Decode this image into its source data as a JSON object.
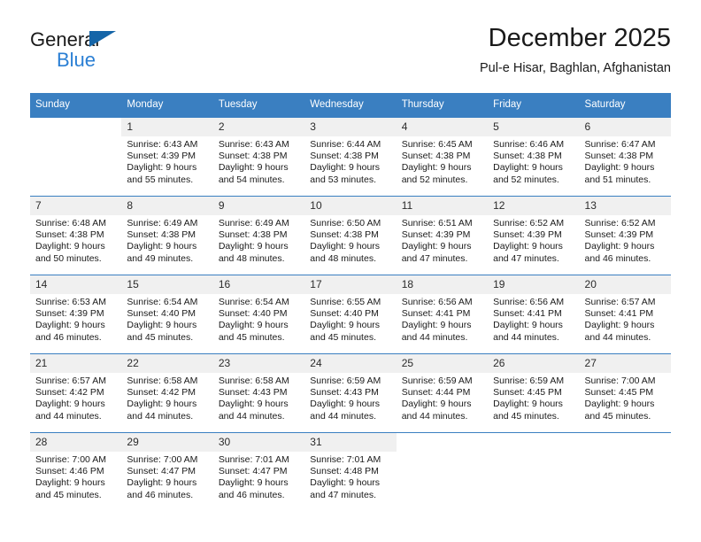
{
  "logo": {
    "word1": "General",
    "word2": "Blue",
    "triangle_color": "#1565a8",
    "word2_color": "#2a7fd4"
  },
  "header": {
    "title": "December 2025",
    "subtitle": "Pul-e Hisar, Baghlan, Afghanistan"
  },
  "theme": {
    "header_blue": "#3a7fc1",
    "daynum_band": "#f0f0f0"
  },
  "calendar": {
    "weekday_headers": [
      "Sunday",
      "Monday",
      "Tuesday",
      "Wednesday",
      "Thursday",
      "Friday",
      "Saturday"
    ],
    "weeks": [
      [
        {
          "day": "",
          "empty": true
        },
        {
          "day": "1",
          "sunrise": "Sunrise: 6:43 AM",
          "sunset": "Sunset: 4:39 PM",
          "daylight": "Daylight: 9 hours and 55 minutes."
        },
        {
          "day": "2",
          "sunrise": "Sunrise: 6:43 AM",
          "sunset": "Sunset: 4:38 PM",
          "daylight": "Daylight: 9 hours and 54 minutes."
        },
        {
          "day": "3",
          "sunrise": "Sunrise: 6:44 AM",
          "sunset": "Sunset: 4:38 PM",
          "daylight": "Daylight: 9 hours and 53 minutes."
        },
        {
          "day": "4",
          "sunrise": "Sunrise: 6:45 AM",
          "sunset": "Sunset: 4:38 PM",
          "daylight": "Daylight: 9 hours and 52 minutes."
        },
        {
          "day": "5",
          "sunrise": "Sunrise: 6:46 AM",
          "sunset": "Sunset: 4:38 PM",
          "daylight": "Daylight: 9 hours and 52 minutes."
        },
        {
          "day": "6",
          "sunrise": "Sunrise: 6:47 AM",
          "sunset": "Sunset: 4:38 PM",
          "daylight": "Daylight: 9 hours and 51 minutes."
        }
      ],
      [
        {
          "day": "7",
          "sunrise": "Sunrise: 6:48 AM",
          "sunset": "Sunset: 4:38 PM",
          "daylight": "Daylight: 9 hours and 50 minutes."
        },
        {
          "day": "8",
          "sunrise": "Sunrise: 6:49 AM",
          "sunset": "Sunset: 4:38 PM",
          "daylight": "Daylight: 9 hours and 49 minutes."
        },
        {
          "day": "9",
          "sunrise": "Sunrise: 6:49 AM",
          "sunset": "Sunset: 4:38 PM",
          "daylight": "Daylight: 9 hours and 48 minutes."
        },
        {
          "day": "10",
          "sunrise": "Sunrise: 6:50 AM",
          "sunset": "Sunset: 4:38 PM",
          "daylight": "Daylight: 9 hours and 48 minutes."
        },
        {
          "day": "11",
          "sunrise": "Sunrise: 6:51 AM",
          "sunset": "Sunset: 4:39 PM",
          "daylight": "Daylight: 9 hours and 47 minutes."
        },
        {
          "day": "12",
          "sunrise": "Sunrise: 6:52 AM",
          "sunset": "Sunset: 4:39 PM",
          "daylight": "Daylight: 9 hours and 47 minutes."
        },
        {
          "day": "13",
          "sunrise": "Sunrise: 6:52 AM",
          "sunset": "Sunset: 4:39 PM",
          "daylight": "Daylight: 9 hours and 46 minutes."
        }
      ],
      [
        {
          "day": "14",
          "sunrise": "Sunrise: 6:53 AM",
          "sunset": "Sunset: 4:39 PM",
          "daylight": "Daylight: 9 hours and 46 minutes."
        },
        {
          "day": "15",
          "sunrise": "Sunrise: 6:54 AM",
          "sunset": "Sunset: 4:40 PM",
          "daylight": "Daylight: 9 hours and 45 minutes."
        },
        {
          "day": "16",
          "sunrise": "Sunrise: 6:54 AM",
          "sunset": "Sunset: 4:40 PM",
          "daylight": "Daylight: 9 hours and 45 minutes."
        },
        {
          "day": "17",
          "sunrise": "Sunrise: 6:55 AM",
          "sunset": "Sunset: 4:40 PM",
          "daylight": "Daylight: 9 hours and 45 minutes."
        },
        {
          "day": "18",
          "sunrise": "Sunrise: 6:56 AM",
          "sunset": "Sunset: 4:41 PM",
          "daylight": "Daylight: 9 hours and 44 minutes."
        },
        {
          "day": "19",
          "sunrise": "Sunrise: 6:56 AM",
          "sunset": "Sunset: 4:41 PM",
          "daylight": "Daylight: 9 hours and 44 minutes."
        },
        {
          "day": "20",
          "sunrise": "Sunrise: 6:57 AM",
          "sunset": "Sunset: 4:41 PM",
          "daylight": "Daylight: 9 hours and 44 minutes."
        }
      ],
      [
        {
          "day": "21",
          "sunrise": "Sunrise: 6:57 AM",
          "sunset": "Sunset: 4:42 PM",
          "daylight": "Daylight: 9 hours and 44 minutes."
        },
        {
          "day": "22",
          "sunrise": "Sunrise: 6:58 AM",
          "sunset": "Sunset: 4:42 PM",
          "daylight": "Daylight: 9 hours and 44 minutes."
        },
        {
          "day": "23",
          "sunrise": "Sunrise: 6:58 AM",
          "sunset": "Sunset: 4:43 PM",
          "daylight": "Daylight: 9 hours and 44 minutes."
        },
        {
          "day": "24",
          "sunrise": "Sunrise: 6:59 AM",
          "sunset": "Sunset: 4:43 PM",
          "daylight": "Daylight: 9 hours and 44 minutes."
        },
        {
          "day": "25",
          "sunrise": "Sunrise: 6:59 AM",
          "sunset": "Sunset: 4:44 PM",
          "daylight": "Daylight: 9 hours and 44 minutes."
        },
        {
          "day": "26",
          "sunrise": "Sunrise: 6:59 AM",
          "sunset": "Sunset: 4:45 PM",
          "daylight": "Daylight: 9 hours and 45 minutes."
        },
        {
          "day": "27",
          "sunrise": "Sunrise: 7:00 AM",
          "sunset": "Sunset: 4:45 PM",
          "daylight": "Daylight: 9 hours and 45 minutes."
        }
      ],
      [
        {
          "day": "28",
          "sunrise": "Sunrise: 7:00 AM",
          "sunset": "Sunset: 4:46 PM",
          "daylight": "Daylight: 9 hours and 45 minutes."
        },
        {
          "day": "29",
          "sunrise": "Sunrise: 7:00 AM",
          "sunset": "Sunset: 4:47 PM",
          "daylight": "Daylight: 9 hours and 46 minutes."
        },
        {
          "day": "30",
          "sunrise": "Sunrise: 7:01 AM",
          "sunset": "Sunset: 4:47 PM",
          "daylight": "Daylight: 9 hours and 46 minutes."
        },
        {
          "day": "31",
          "sunrise": "Sunrise: 7:01 AM",
          "sunset": "Sunset: 4:48 PM",
          "daylight": "Daylight: 9 hours and 47 minutes."
        },
        {
          "day": "",
          "empty": true
        },
        {
          "day": "",
          "empty": true
        },
        {
          "day": "",
          "empty": true
        }
      ]
    ]
  }
}
